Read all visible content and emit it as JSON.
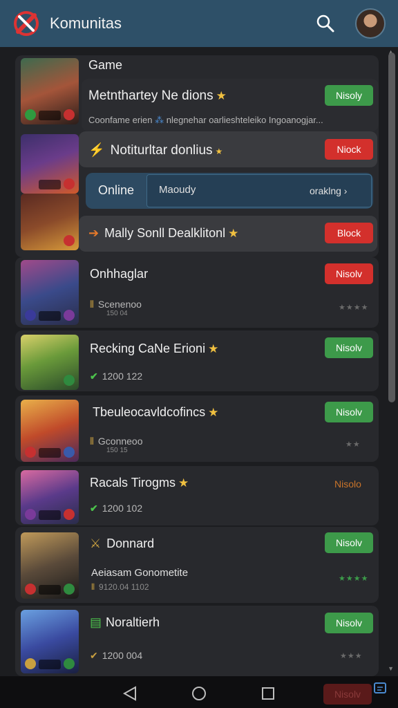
{
  "header": {
    "title": "Komunitas",
    "logo_icon": "x-logo-icon",
    "search_icon": "search-icon"
  },
  "section": {
    "title": "Game"
  },
  "games": [
    {
      "title": "Metnthartey Ne dions",
      "desc": "Coonfame erien",
      "desc2": "nlegnehar oarlieshteleiko Ingoanogjar...",
      "button": "Nisoly",
      "button_color": "green"
    },
    {
      "title": "Notiturltar donlius",
      "button": "Niock",
      "button_color": "red"
    },
    {
      "title": "Mally Sonll Dealklitonl",
      "button": "Block",
      "button_color": "red"
    },
    {
      "title": "Onhhaglar",
      "sub": "Scenenoo",
      "meta": "150 04",
      "rating": "★★★★",
      "button": "Nisolv",
      "button_color": "red"
    },
    {
      "title": "Recking CaNe Erioni",
      "sub": "1200 122",
      "button": "Nisolv",
      "button_color": "green"
    },
    {
      "title": "Tbeuleocavldcofincs",
      "sub": "Gconneoo",
      "meta": "150 15",
      "rating": "★★",
      "button": "Nisolv",
      "button_color": "green"
    },
    {
      "title": "Racals Tirogms",
      "sub": "1200 102",
      "button": "Nisolo"
    },
    {
      "title": "Donnard",
      "sub": "Aeiasam Gonometite",
      "meta": "9120.04 1102",
      "rating": "★★★★",
      "button": "Nisolv",
      "button_color": "green"
    },
    {
      "title": "Noraltierh",
      "sub": "1200 004",
      "rating": "★★★",
      "button": "Nisolv",
      "button_color": "green"
    }
  ],
  "online": {
    "label": "Online",
    "field_value": "Maoudy",
    "link": "oraklng ›"
  },
  "bottom_button": "Nisolv",
  "colors": {
    "header": "#2e5068",
    "green": "#3d9a4a",
    "red": "#d3302c",
    "background": "#1c1d20"
  }
}
